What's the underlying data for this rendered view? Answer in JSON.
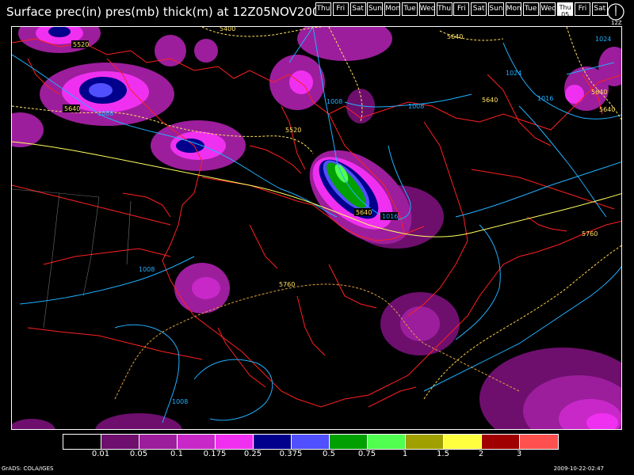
{
  "title": "Surface prec(in) pres(mb) thick(m) at 12Z05NOV2009",
  "days": [
    "Thu",
    "Fri",
    "Sat",
    "Sun",
    "Mon",
    "Tue",
    "Wed",
    "Thu",
    "Fri",
    "Sat",
    "Sun",
    "Mon",
    "Tue",
    "Wed",
    "Thu",
    "Fri",
    "Sat"
  ],
  "active_day_label": "Thu",
  "active_day_sub": "05",
  "clock_label": "12Z",
  "legend": {
    "colors": [
      "#000000",
      "#6e0f6e",
      "#9c1e9c",
      "#c828c8",
      "#f030f0",
      "#00008c",
      "#5050ff",
      "#00a000",
      "#50ff50",
      "#a0a000",
      "#ffff40",
      "#a00000",
      "#ff5050"
    ],
    "ticks": [
      "0.01",
      "0.05",
      "0.1",
      "0.175",
      "0.25",
      "0.375",
      "0.5",
      "0.75",
      "1",
      "1.5",
      "2",
      "3"
    ]
  },
  "contour_labels": {
    "l5400": "5400",
    "l5520a": "5520",
    "l5520b": "5520",
    "l5640a": "5640",
    "l5640b": "5640",
    "l5640c": "5640",
    "l5640d": "5640",
    "l5640e": "5640",
    "l5640f": "5640",
    "l5760a": "5760",
    "l5760b": "5760",
    "l1008a": "1008",
    "l1008b": "1008",
    "l1008c": "1008",
    "l1008d": "1008",
    "l1008e": "1008",
    "l1016a": "1016",
    "l1016b": "1016",
    "l1024a": "1024",
    "l1024b": "1024"
  },
  "footer_left": "GrADS: COLA/IGES",
  "footer_right": "2009-10-22-02:47"
}
